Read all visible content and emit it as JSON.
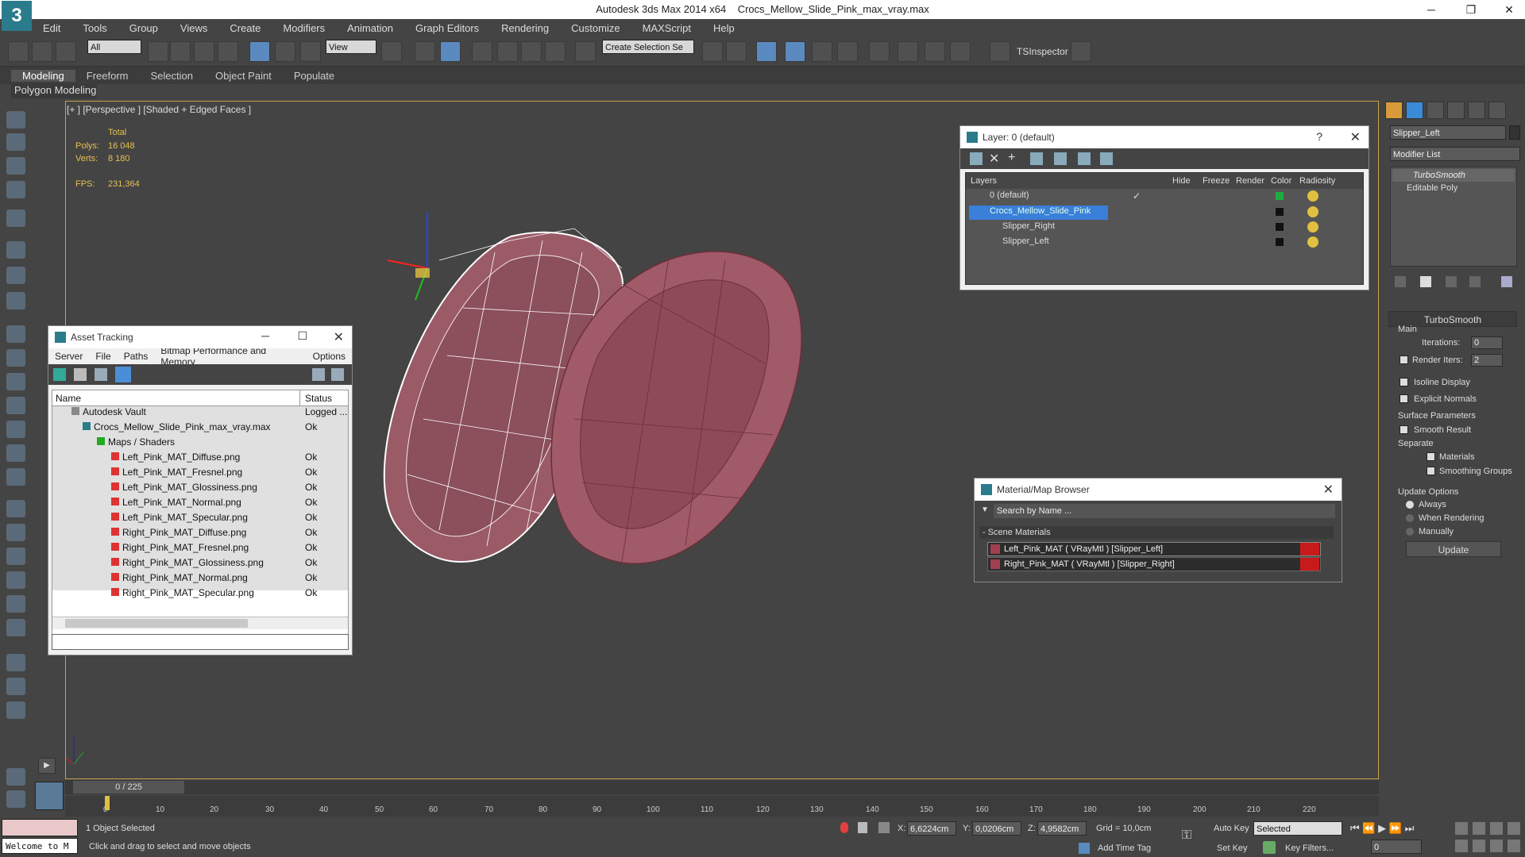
{
  "app": {
    "title": "Autodesk 3ds Max  2014 x64",
    "file": "Crocs_Mellow_Slide_Pink_max_vray.max",
    "logo": "3"
  },
  "menu": [
    "Edit",
    "Tools",
    "Group",
    "Views",
    "Create",
    "Modifiers",
    "Animation",
    "Graph Editors",
    "Rendering",
    "Customize",
    "MAXScript",
    "Help"
  ],
  "toolbar": {
    "filter_select": "All",
    "ref_coord": "View",
    "named_selection": "Create Selection Se",
    "tsinspector": "TSInspector"
  },
  "ribbon": {
    "tabs": [
      "Modeling",
      "Freeform",
      "Selection",
      "Object Paint",
      "Populate"
    ],
    "sub": "Polygon Modeling"
  },
  "viewport": {
    "label": "[+ ] [Perspective ] [Shaded + Edged Faces ]",
    "stats": {
      "total": "Total",
      "polys_label": "Polys:",
      "polys": "16 048",
      "verts_label": "Verts:",
      "verts": "8 180",
      "fps_label": "FPS:",
      "fps": "231,364"
    }
  },
  "asset_tracking": {
    "title": "Asset Tracking",
    "menu": [
      "Server",
      "File",
      "Paths",
      "Bitmap Performance and Memory",
      "Options"
    ],
    "col_name": "Name",
    "col_status": "Status",
    "rows": [
      {
        "name": "Autodesk Vault",
        "status": "Logged ..."
      },
      {
        "name": "Crocs_Mellow_Slide_Pink_max_vray.max",
        "status": "Ok"
      },
      {
        "name": "Maps / Shaders",
        "status": ""
      },
      {
        "name": "Left_Pink_MAT_Diffuse.png",
        "status": "Ok"
      },
      {
        "name": "Left_Pink_MAT_Fresnel.png",
        "status": "Ok"
      },
      {
        "name": "Left_Pink_MAT_Glossiness.png",
        "status": "Ok"
      },
      {
        "name": "Left_Pink_MAT_Normal.png",
        "status": "Ok"
      },
      {
        "name": "Left_Pink_MAT_Specular.png",
        "status": "Ok"
      },
      {
        "name": "Right_Pink_MAT_Diffuse.png",
        "status": "Ok"
      },
      {
        "name": "Right_Pink_MAT_Fresnel.png",
        "status": "Ok"
      },
      {
        "name": "Right_Pink_MAT_Glossiness.png",
        "status": "Ok"
      },
      {
        "name": "Right_Pink_MAT_Normal.png",
        "status": "Ok"
      },
      {
        "name": "Right_Pink_MAT_Specular.png",
        "status": "Ok"
      }
    ]
  },
  "layer": {
    "title": "Layer: 0 (default)",
    "help": "?",
    "cols": {
      "layers": "Layers",
      "hide": "Hide",
      "freeze": "Freeze",
      "render": "Render",
      "color": "Color",
      "radiosity": "Radiosity"
    },
    "rows": [
      {
        "name": "0 (default)",
        "color": "#22aa44"
      },
      {
        "name": "Crocs_Mellow_Slide_Pink",
        "color": "#111111"
      },
      {
        "name": "Slipper_Right",
        "color": "#111111"
      },
      {
        "name": "Slipper_Left",
        "color": "#111111"
      }
    ]
  },
  "material_browser": {
    "title": "Material/Map Browser",
    "search_placeholder": "Search by Name ...",
    "section": "- Scene Materials",
    "items": [
      "Left_Pink_MAT  ( VRayMtl )  [Slipper_Left]",
      "Right_Pink_MAT  ( VRayMtl )  [Slipper_Right]"
    ]
  },
  "command_panel": {
    "object_name": "Slipper_Left",
    "modifier_list": "Modifier List",
    "stack": [
      "TurboSmooth",
      "Editable Poly"
    ],
    "rollout": "TurboSmooth",
    "main": "Main",
    "iterations_label": "Iterations:",
    "iterations": "0",
    "render_iters_label": "Render Iters:",
    "render_iters": "2",
    "isoline": "Isoline Display",
    "explicit": "Explicit Normals",
    "surface": "Surface Parameters",
    "smooth_result": "Smooth Result",
    "separate": "Separate",
    "materials": "Materials",
    "smoothing_groups": "Smoothing Groups",
    "update_options": "Update Options",
    "always": "Always",
    "when_rendering": "When Rendering",
    "manually": "Manually",
    "update_btn": "Update"
  },
  "timeline": {
    "frame": "0 / 225",
    "ticks": [
      "0",
      "10",
      "20",
      "30",
      "40",
      "50",
      "60",
      "70",
      "80",
      "90",
      "100",
      "110",
      "120",
      "130",
      "140",
      "150",
      "160",
      "170",
      "180",
      "190",
      "200",
      "210",
      "220"
    ]
  },
  "status": {
    "listener": "Welcome to M",
    "selected": "1 Object Selected",
    "prompt": "Click and drag to select and move objects",
    "x_label": "X:",
    "x": "6,6224cm",
    "y_label": "Y:",
    "y": "0,0206cm",
    "z_label": "Z:",
    "z": "4,9582cm",
    "grid": "Grid = 10,0cm",
    "add_time_tag": "Add Time Tag",
    "auto_key": "Auto Key",
    "set_key": "Set Key",
    "key_mode": "Selected",
    "key_filters": "Key Filters...",
    "frame_field": "0"
  }
}
